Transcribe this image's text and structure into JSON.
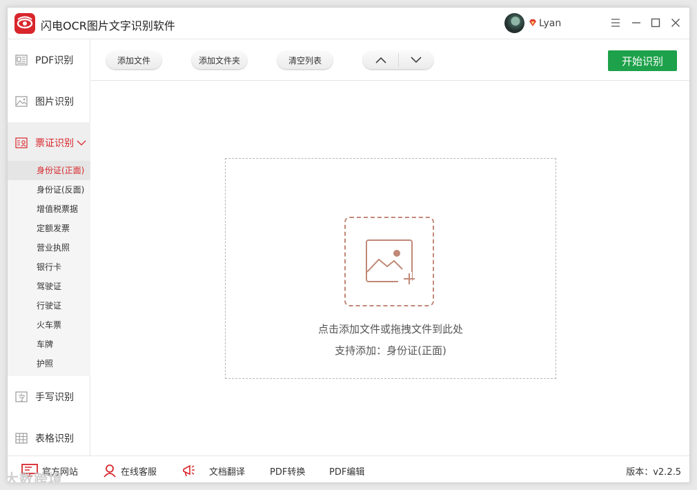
{
  "app": {
    "title": "闪电OCR图片文字识别软件",
    "username": "Lyan"
  },
  "sidebar": {
    "items": [
      {
        "label": "PDF识别",
        "icon": "pdf-icon"
      },
      {
        "label": "图片识别",
        "icon": "image-icon"
      },
      {
        "label": "票证识别",
        "icon": "ticket-scan-icon",
        "active": true,
        "expanded": true
      },
      {
        "label": "手写识别",
        "icon": "handwriting-icon"
      },
      {
        "label": "表格识别",
        "icon": "table-icon"
      }
    ],
    "sub_items": [
      "身份证(正面)",
      "身份证(反面)",
      "增值税票据",
      "定额发票",
      "营业执照",
      "银行卡",
      "驾驶证",
      "行驶证",
      "火车票",
      "车牌",
      "护照"
    ],
    "active_sub_index": 0
  },
  "toolbar": {
    "add_file": "添加文件",
    "add_folder": "添加文件夹",
    "clear_list": "清空列表",
    "start": "开始识别"
  },
  "dropzone": {
    "hint": "点击添加文件或拖拽文件到此处",
    "support": "支持添加：身份证(正面)"
  },
  "bottombar": {
    "website": "官方网站",
    "support": "在线客服",
    "translate": "文档翻译",
    "pdf_convert": "PDF转换",
    "pdf_edit": "PDF编辑",
    "version": "版本：v2.2.5"
  },
  "watermark": "大数跨境",
  "colors": {
    "accent": "#d8262c",
    "start": "#1da14a",
    "dropzone_icon": "#c08876"
  }
}
